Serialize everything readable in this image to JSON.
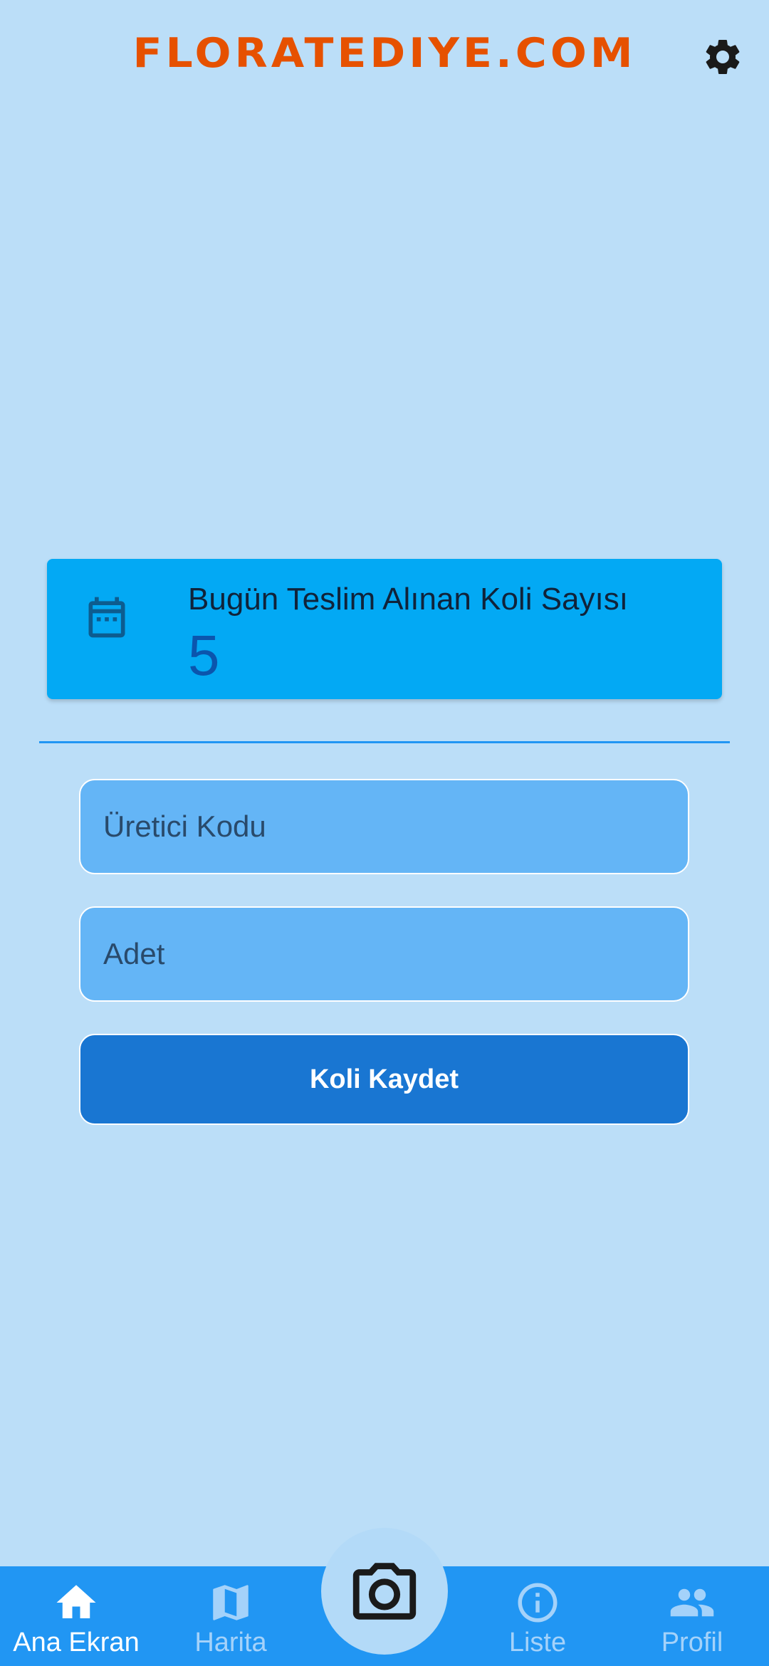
{
  "header": {
    "title": "FLORATEDIYE.COM",
    "settings_icon": "gear-icon",
    "title_color": "#E65100"
  },
  "stat_card": {
    "icon": "calendar-icon",
    "label": "Bugün Teslim Alınan Koli Sayısı",
    "value": "5",
    "background": "#03A9F4"
  },
  "form": {
    "code_placeholder": "Üretici Kodu",
    "code_value": "",
    "quantity_placeholder": "Adet",
    "quantity_value": "",
    "save_label": "Koli Kaydet"
  },
  "bottom_nav": {
    "items": [
      {
        "label": "Ana Ekran",
        "icon": "home-icon",
        "active": true
      },
      {
        "label": "Harita",
        "icon": "map-icon",
        "active": false
      },
      {
        "label": "Liste",
        "icon": "info-icon",
        "active": false
      },
      {
        "label": "Profil",
        "icon": "people-icon",
        "active": false
      }
    ],
    "center_icon": "camera-icon",
    "background": "#2196F3"
  }
}
